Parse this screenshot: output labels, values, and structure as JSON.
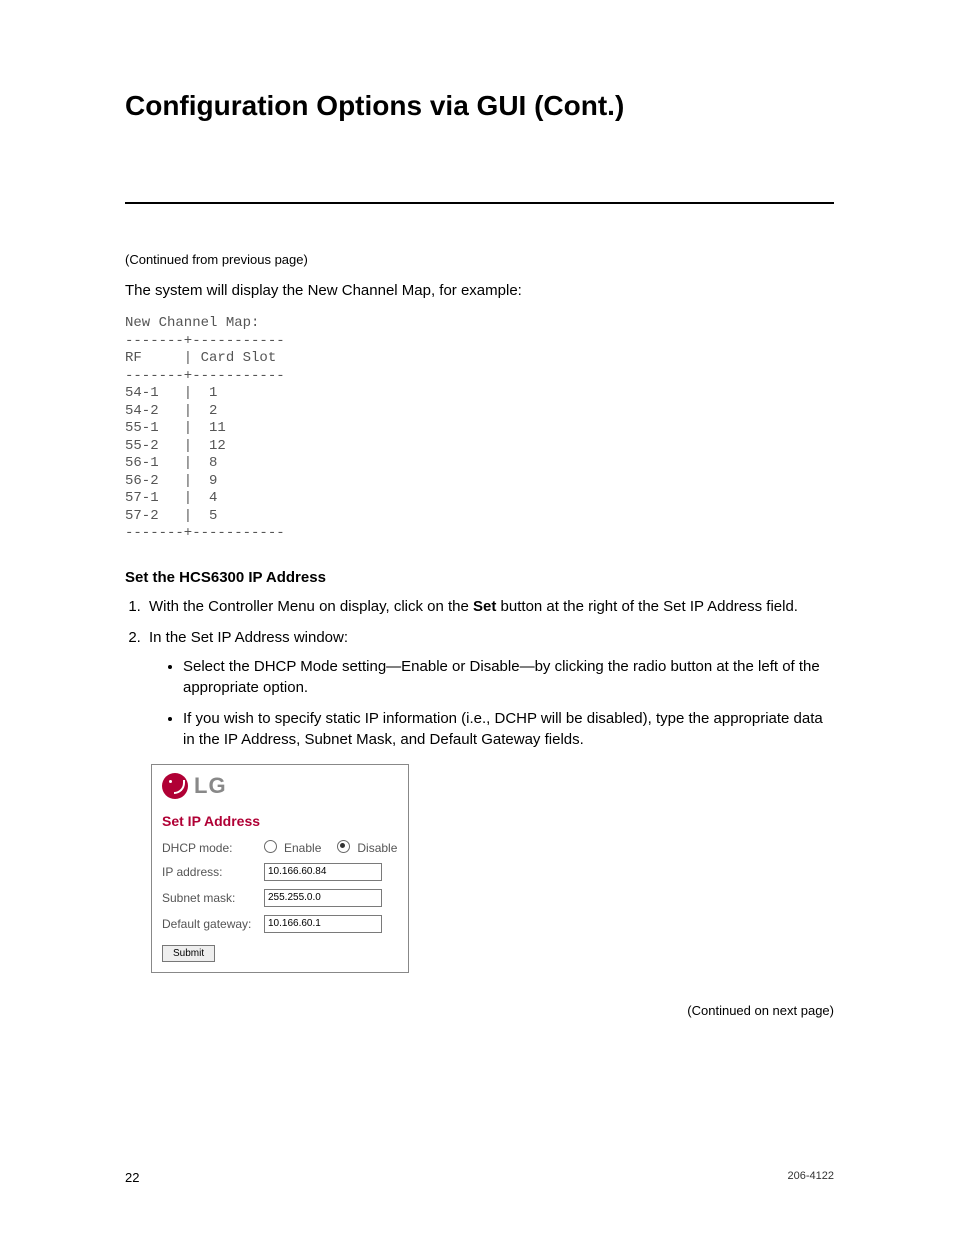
{
  "title": "Configuration Options via GUI (Cont.)",
  "cont_prev": "(Continued from previous page)",
  "intro": "The system will display the New Channel Map, for example:",
  "channel_map_block": "New Channel Map:\n-------+-----------\nRF     | Card Slot\n-------+-----------\n54-1   |  1\n54-2   |  2\n55-1   |  11\n55-2   |  12\n56-1   |  8\n56-2   |  9\n57-1   |  4\n57-2   |  5\n-------+-----------",
  "channel_map": {
    "header": {
      "col1": "RF",
      "col2": "Card Slot"
    },
    "rows": [
      {
        "rf": "54-1",
        "slot": "1"
      },
      {
        "rf": "54-2",
        "slot": "2"
      },
      {
        "rf": "55-1",
        "slot": "11"
      },
      {
        "rf": "55-2",
        "slot": "12"
      },
      {
        "rf": "56-1",
        "slot": "8"
      },
      {
        "rf": "56-2",
        "slot": "9"
      },
      {
        "rf": "57-1",
        "slot": "4"
      },
      {
        "rf": "57-2",
        "slot": "5"
      }
    ]
  },
  "section_head": "Set the HCS6300 IP Address",
  "step1_pre": "With the Controller Menu on display, click on the ",
  "step1_bold": "Set",
  "step1_post": " button at the right of the Set IP Address field.",
  "step2": "In the Set IP Address window:",
  "bullet1": "Select the DHCP Mode setting—Enable or Disable—by clicking the radio button at the left of the appropriate option.",
  "bullet2": "If you wish to specify static IP information (i.e., DCHP will be disabled), type the appropriate data in the IP Address, Subnet Mask, and Default Gateway fields.",
  "panel": {
    "brand": "LG",
    "title": "Set IP Address",
    "dhcp_label": "DHCP mode:",
    "enable": "Enable",
    "disable": "Disable",
    "dhcp_selected": "Disable",
    "ip_label": "IP address:",
    "ip_value": "10.166.60.84",
    "mask_label": "Subnet mask:",
    "mask_value": "255.255.0.0",
    "gw_label": "Default gateway:",
    "gw_value": "10.166.60.1",
    "submit": "Submit"
  },
  "cont_next": "(Continued on next page)",
  "footer": {
    "page": "22",
    "doc": "206-4122"
  }
}
